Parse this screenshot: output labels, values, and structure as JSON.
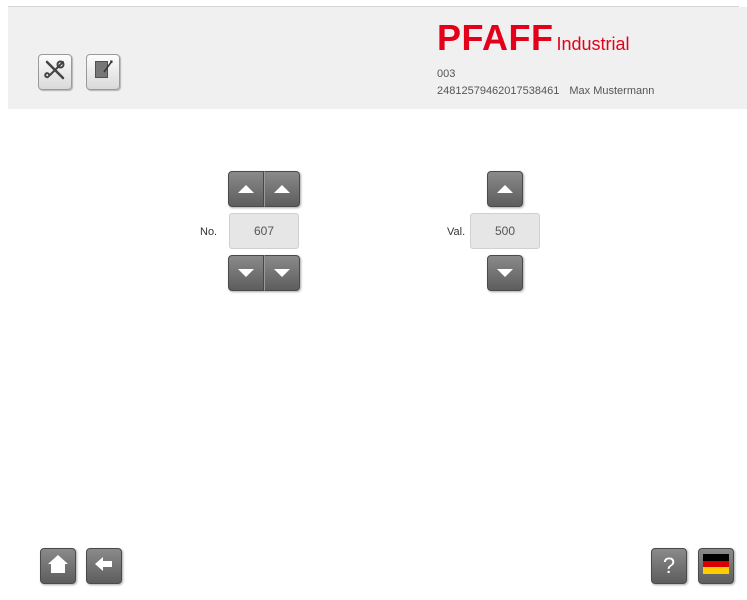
{
  "header": {
    "brand_main": "PFAFF",
    "brand_sub": "Industrial",
    "machine_code": "003",
    "serial": "24812579462017538461",
    "user": "Max Mustermann",
    "brand_color": "#e2001a",
    "tools": [
      {
        "icon": "wrench-screwdriver-icon"
      },
      {
        "icon": "notepad-edit-icon"
      }
    ]
  },
  "parameter": {
    "number_label": "No.",
    "number_value": "607",
    "value_label": "Val.",
    "value_value": "500"
  },
  "footer": {
    "home_icon": "home-icon",
    "back_icon": "back-arrow-icon",
    "help_label": "?",
    "language_icon": "german-flag-icon"
  }
}
